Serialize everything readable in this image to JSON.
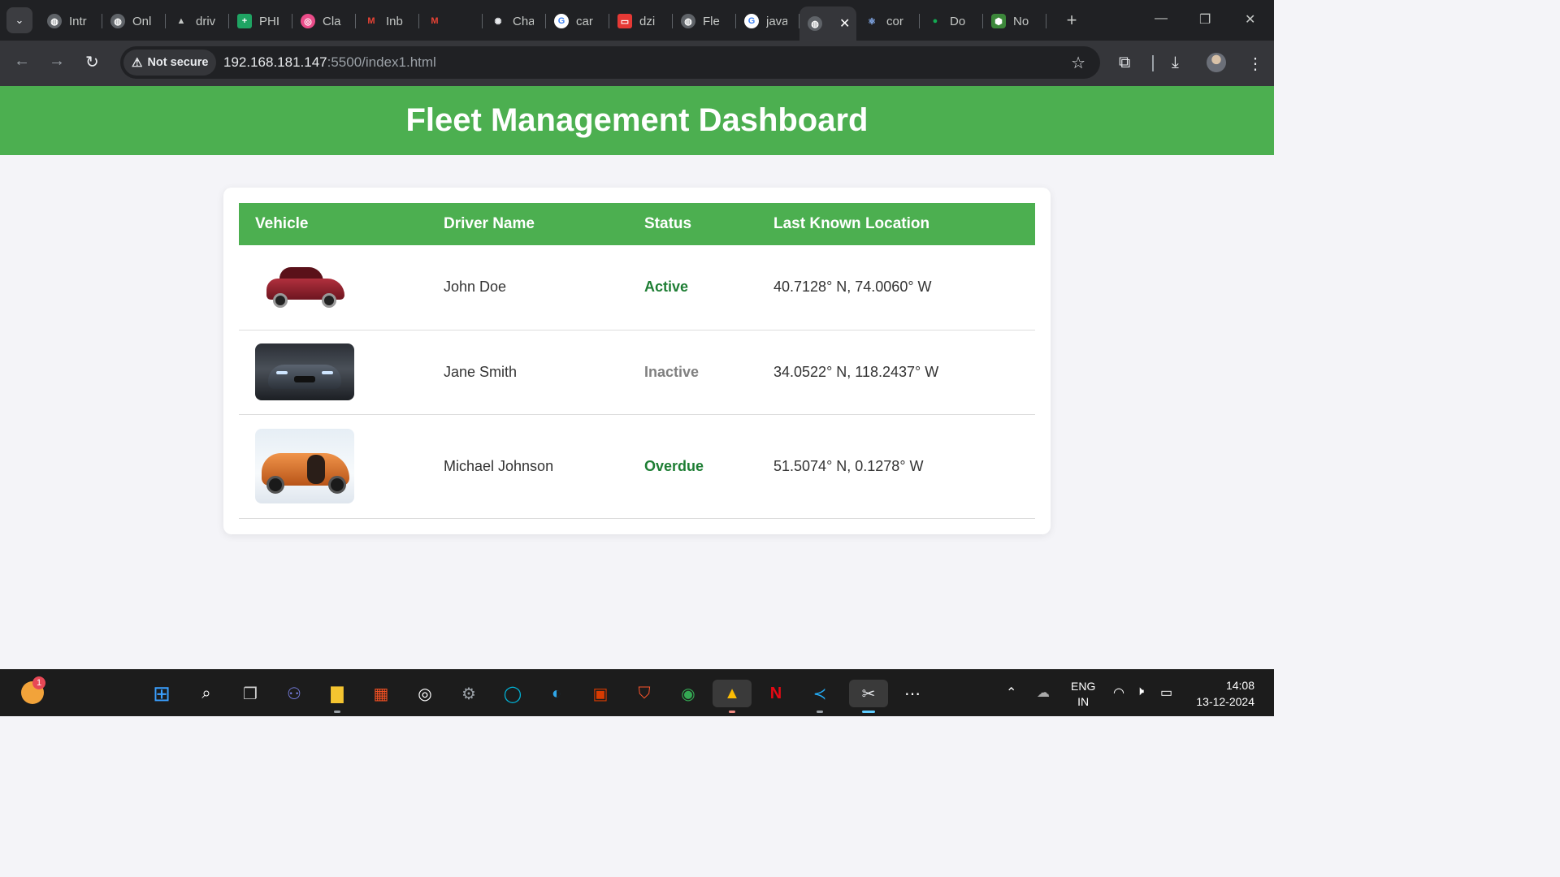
{
  "browser": {
    "tabs": [
      {
        "label": "Intr",
        "icon": "globe-icon"
      },
      {
        "label": "Onl",
        "icon": "globe-icon"
      },
      {
        "label": "driv",
        "icon": "drive-icon"
      },
      {
        "label": "PHI",
        "icon": "sheets-icon"
      },
      {
        "label": "Cla",
        "icon": "dribbble-icon"
      },
      {
        "label": "Inb",
        "icon": "gmail-icon"
      },
      {
        "label": "",
        "icon": "gmail-rocket-icon"
      },
      {
        "label": "Cha",
        "icon": "chatgpt-icon"
      },
      {
        "label": "car",
        "icon": "google-icon"
      },
      {
        "label": "dzi",
        "icon": "video-icon"
      },
      {
        "label": "Fle",
        "icon": "globe-icon"
      },
      {
        "label": "java",
        "icon": "google-icon"
      },
      {
        "label": "",
        "icon": "globe-icon",
        "active": true
      },
      {
        "label": "cor",
        "icon": "react-icon"
      },
      {
        "label": "Do",
        "icon": "mongodb-icon"
      },
      {
        "label": "No",
        "icon": "nodejs-icon"
      }
    ],
    "security_label": "Not secure",
    "url_host": "192.168.181.147",
    "url_path": ":5500/index1.html"
  },
  "page": {
    "title": "Fleet Management Dashboard",
    "columns": [
      "Vehicle",
      "Driver Name",
      "Status",
      "Last Known Location"
    ],
    "rows": [
      {
        "vehicle_image": "red-sedan-image",
        "driver": "John Doe",
        "status": "Active",
        "location": "40.7128° N, 74.0060° W"
      },
      {
        "vehicle_image": "grey-sports-car-image",
        "driver": "Jane Smith",
        "status": "Inactive",
        "location": "34.0522° N, 118.2437° W"
      },
      {
        "vehicle_image": "orange-hypercar-image",
        "driver": "Michael Johnson",
        "status": "Overdue",
        "location": "51.5074° N, 0.1278° W"
      }
    ]
  },
  "taskbar": {
    "notification_count": "1",
    "language": "ENG",
    "region": "IN",
    "time": "14:08",
    "date": "13-12-2024"
  },
  "colors": {
    "header_green": "#4caf50",
    "status_active": "#1e7e34",
    "status_inactive": "#808080"
  }
}
